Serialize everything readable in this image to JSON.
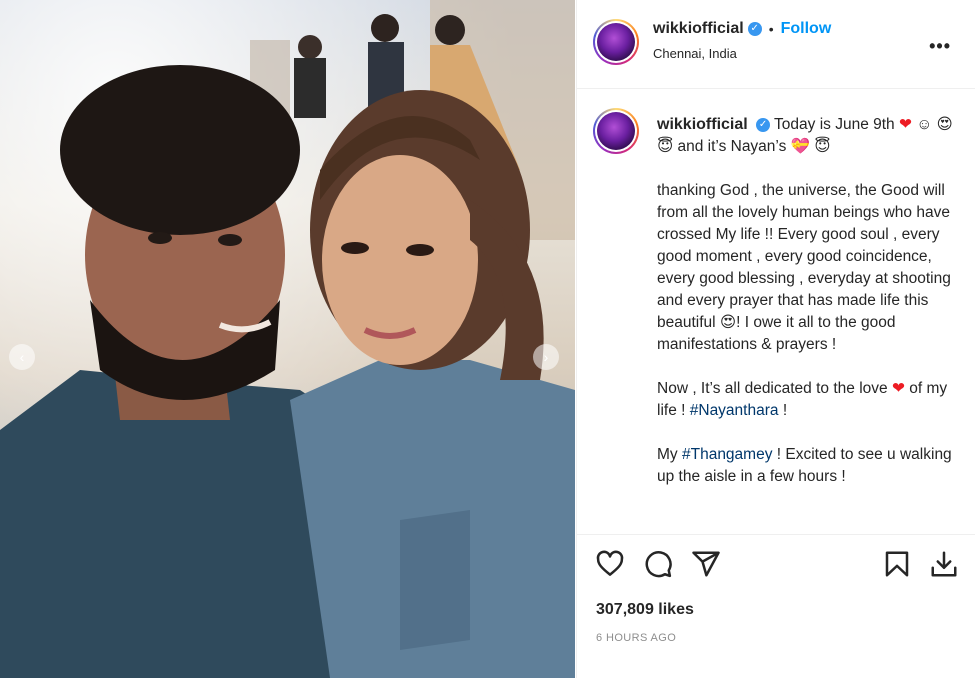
{
  "post": {
    "username": "wikkiofficial",
    "verified_glyph": "✓",
    "separator": "•",
    "follow_label": "Follow",
    "location": "Chennai, India",
    "more_icon": "more-options-icon",
    "more_glyph": "•••"
  },
  "media": {
    "prev_arrow": "‹",
    "next_arrow": "›"
  },
  "caption": {
    "username": "wikkiofficial",
    "line1": "Today is June 9th",
    "heart": "❤",
    "smile": "☺",
    "emoji_heart_eyes": "😍",
    "emoji_halo": "😇",
    "line1b": "and it’s Nayan’s",
    "emoji_gift_heart": "💝",
    "para1": "thanking God , the universe, the Good will from all the lovely human beings who have crossed My life !! Every good soul , every good moment , every good coincidence, every good blessing , everyday at shooting and every prayer that has made life this beautiful",
    "para1_end": "! I owe it all to the good manifestations & prayers !",
    "para2_a": "Now , It’s all dedicated to the love",
    "para2_b": "of my life !",
    "para2_tag": "#Nayanthara",
    "para2_end": "!",
    "para3_a": "My",
    "para3_tag": "#Thangamey",
    "para3_b": "! Excited to see u walking up the aisle in a few hours !"
  },
  "actions": {
    "like_icon": "heart-icon",
    "comment_icon": "comment-icon",
    "share_icon": "share-icon",
    "save_icon": "bookmark-icon",
    "download_icon": "download-icon"
  },
  "likes": "307,809 likes",
  "time_ago": "6 HOURS AGO"
}
